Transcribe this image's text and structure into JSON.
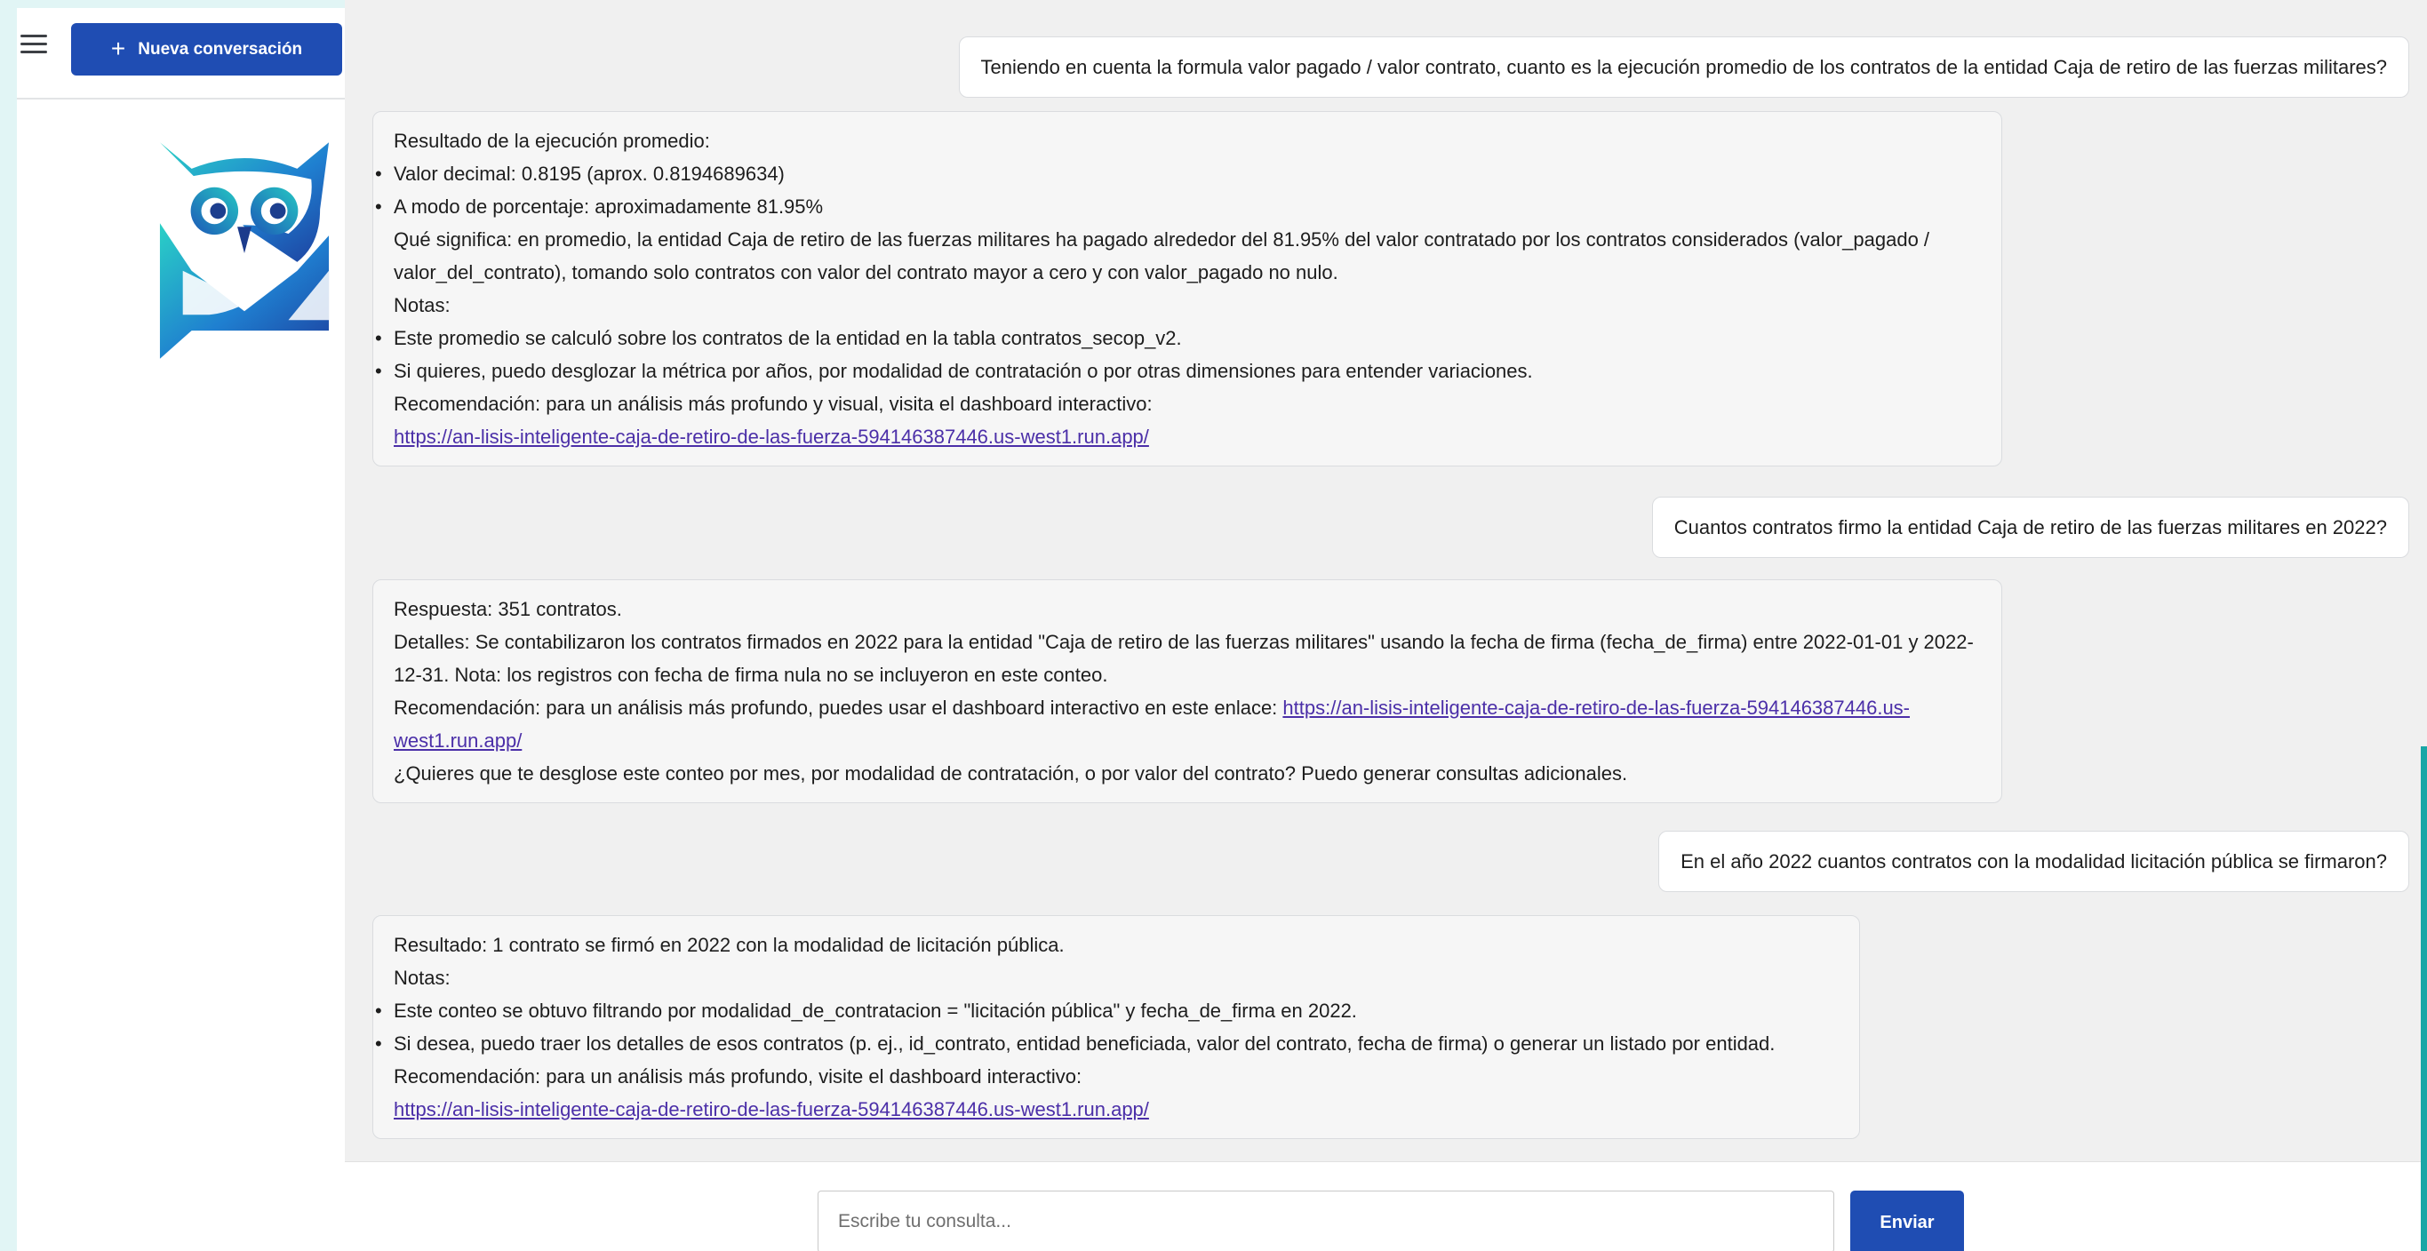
{
  "sidebar": {
    "new_chat_label": "Nueva conversación"
  },
  "conversation": {
    "messages": [
      {
        "role": "user",
        "text": "Teniendo en cuenta la formula valor pagado / valor contrato, cuanto es la ejecución promedio de los contratos de la entidad Caja de retiro de las fuerzas militares?"
      },
      {
        "role": "assistant",
        "heading": "Resultado de la ejecución promedio:",
        "bullets1": [
          "Valor decimal: 0.8195 (aprox. 0.8194689634)",
          "A modo de porcentaje: aproximadamente 81.95%"
        ],
        "meaning": "Qué significa: en promedio, la entidad Caja de retiro de las fuerzas militares ha pagado alrededor del 81.95% del valor contratado por los contratos considerados (valor_pagado / valor_del_contrato), tomando solo contratos con valor del contrato mayor a cero y con valor_pagado no nulo.",
        "notes_label": "Notas:",
        "bullets2": [
          "Este promedio se calculó sobre los contratos de la entidad en la tabla contratos_secop_v2.",
          "Si quieres, puedo desglozar la métrica por años, por modalidad de contratación o por otras dimensiones para entender variaciones."
        ],
        "recommendation": "Recomendación: para un análisis más profundo y visual, visita el dashboard interactivo:",
        "link": "https://an-lisis-inteligente-caja-de-retiro-de-las-fuerza-594146387446.us-west1.run.app/"
      },
      {
        "role": "user",
        "text": "Cuantos contratos firmo la entidad Caja de retiro de las fuerzas militares en 2022?"
      },
      {
        "role": "assistant",
        "answer": "Respuesta: 351 contratos.",
        "details": "Detalles: Se contabilizaron los contratos firmados en 2022 para la entidad \"Caja de retiro de las fuerzas militares\" usando la fecha de firma (fecha_de_firma) entre 2022-01-01 y 2022-12-31. Nota: los registros con fecha de firma nula no se incluyeron en este conteo.",
        "recommendation": "Recomendación: para un análisis más profundo, puedes usar el dashboard interactivo en este enlace:",
        "link": "https://an-lisis-inteligente-caja-de-retiro-de-las-fuerza-594146387446.us-west1.run.app/",
        "followup": "¿Quieres que te desglose este conteo por mes, por modalidad de contratación, o por valor del contrato? Puedo generar consultas adicionales."
      },
      {
        "role": "user",
        "text": "En el año 2022 cuantos contratos con la modalidad licitación pública se firmaron?"
      },
      {
        "role": "assistant",
        "result": "Resultado: 1 contrato se firmó en 2022 con la modalidad de licitación pública.",
        "notes_label": "Notas:",
        "bullets": [
          "Este conteo se obtuvo filtrando por modalidad_de_contratacion = \"licitación pública\" y fecha_de_firma en 2022.",
          "Si desea, puedo traer los detalles de esos contratos (p. ej., id_contrato, entidad beneficiada, valor del contrato, fecha de firma) o generar un listado por entidad."
        ],
        "recommendation": "Recomendación: para un análisis más profundo, visite el dashboard interactivo:",
        "link": "https://an-lisis-inteligente-caja-de-retiro-de-las-fuerza-594146387446.us-west1.run.app/"
      }
    ]
  },
  "composer": {
    "placeholder": "Escribe tu consulta...",
    "send_label": "Enviar"
  },
  "colors": {
    "brand_blue": "#1f4db3",
    "background": "#e1f5f5",
    "teal_accent": "#1aa6a6",
    "link": "#4b2fa8"
  }
}
